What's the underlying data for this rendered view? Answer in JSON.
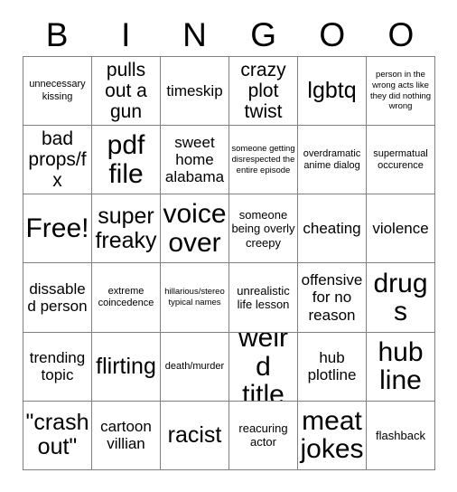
{
  "header": {
    "letters": [
      "B",
      "I",
      "N",
      "G",
      "O",
      "O"
    ]
  },
  "grid": {
    "columns": 6,
    "rows": 6,
    "cells": [
      {
        "text": "unnecessary kissing",
        "size": "xs"
      },
      {
        "text": "pulls out a gun",
        "size": "lg"
      },
      {
        "text": "timeskip",
        "size": "md"
      },
      {
        "text": "crazy plot twist",
        "size": "lg"
      },
      {
        "text": "lgbtq",
        "size": "xl"
      },
      {
        "text": "person in the wrong acts like they did nothing wrong",
        "size": "xxs"
      },
      {
        "text": "bad props/fx",
        "size": "lg"
      },
      {
        "text": "pdf file",
        "size": "xxl"
      },
      {
        "text": "sweet home alabama",
        "size": "md"
      },
      {
        "text": "someone getting disrespected the entire episode",
        "size": "xxs"
      },
      {
        "text": "overdramatic anime dialog",
        "size": "xs"
      },
      {
        "text": "supermatual occurence",
        "size": "xs"
      },
      {
        "text": "Free!",
        "size": "xxl"
      },
      {
        "text": "super freaky",
        "size": "xl"
      },
      {
        "text": "voice over",
        "size": "xxl"
      },
      {
        "text": "someone being overly creepy",
        "size": "sm"
      },
      {
        "text": "cheating",
        "size": "md"
      },
      {
        "text": "violence",
        "size": "md"
      },
      {
        "text": "dissabled person",
        "size": "md"
      },
      {
        "text": "extreme coincedence",
        "size": "xs"
      },
      {
        "text": "hillarious/stereo typical names",
        "size": "xxs"
      },
      {
        "text": "unrealistic life lesson",
        "size": "sm"
      },
      {
        "text": "offensive for no reason",
        "size": "md"
      },
      {
        "text": "drugs",
        "size": "xxl"
      },
      {
        "text": "trending topic",
        "size": "md"
      },
      {
        "text": "flirting",
        "size": "xl"
      },
      {
        "text": "death/murder",
        "size": "xs"
      },
      {
        "text": "weird title",
        "size": "xxl"
      },
      {
        "text": "hub plotline",
        "size": "md"
      },
      {
        "text": "hub line",
        "size": "xxl"
      },
      {
        "text": "\"crash out\"",
        "size": "xl"
      },
      {
        "text": "cartoon villian",
        "size": "md"
      },
      {
        "text": "racist",
        "size": "xl"
      },
      {
        "text": "reacuring actor",
        "size": "sm"
      },
      {
        "text": "meat jokes",
        "size": "xxl"
      },
      {
        "text": "flashback",
        "size": "sm"
      }
    ]
  },
  "colors": {
    "border": "#808080",
    "text": "#000000",
    "background": "#ffffff"
  }
}
